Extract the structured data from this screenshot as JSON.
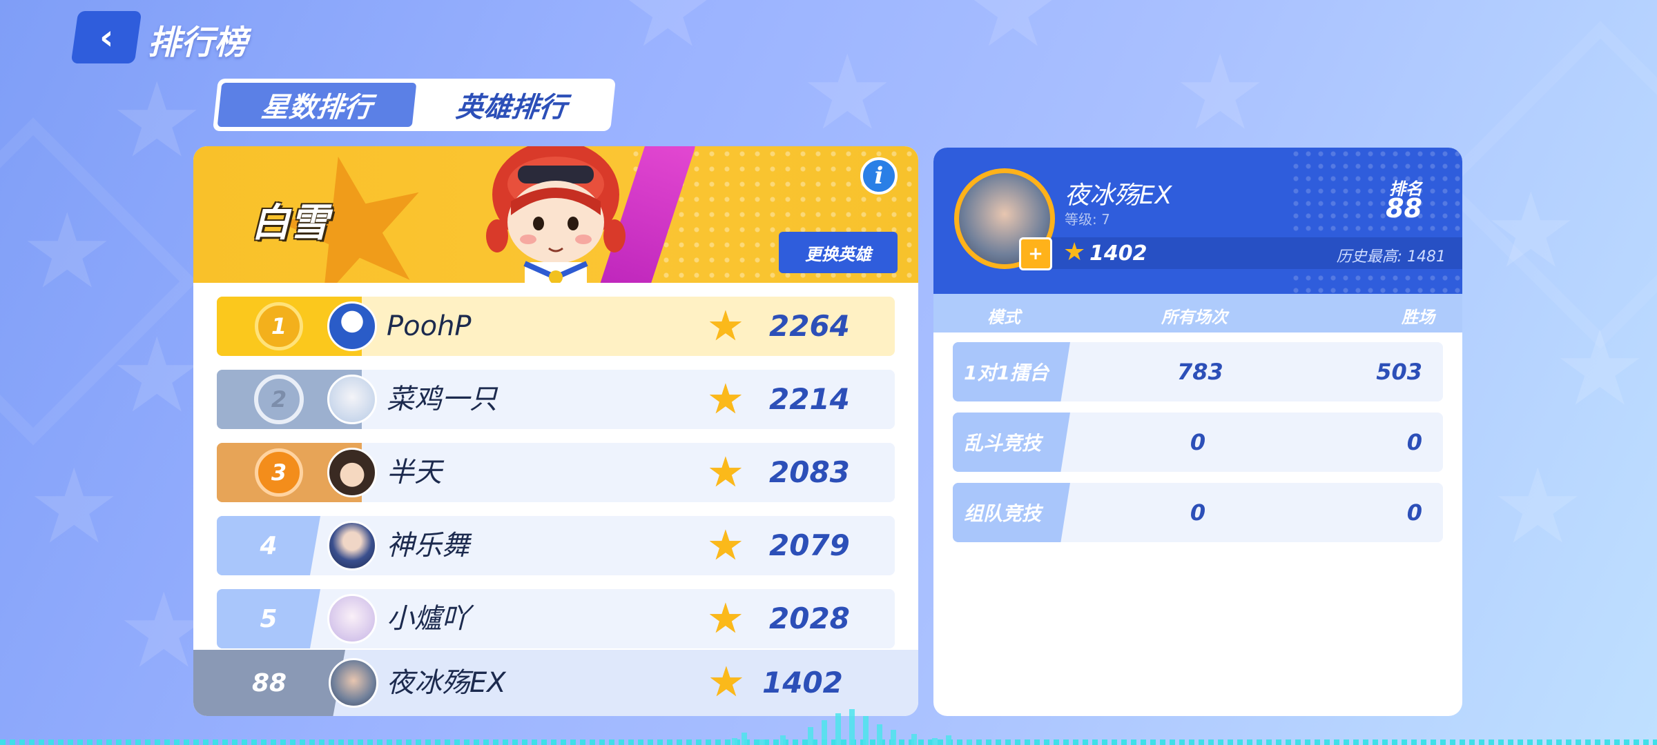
{
  "header": {
    "title": "排行榜"
  },
  "tabs": [
    {
      "label": "星数排行",
      "active": true
    },
    {
      "label": "英雄排行",
      "active": false
    }
  ],
  "hero_banner": {
    "hero_name": "白雪",
    "change_button": "更换英雄"
  },
  "leaderboard": [
    {
      "rank": "1",
      "name": "PoohP",
      "stars": "2264"
    },
    {
      "rank": "2",
      "name": "菜鸡一只",
      "stars": "2214"
    },
    {
      "rank": "3",
      "name": "半天",
      "stars": "2083"
    },
    {
      "rank": "4",
      "name": "神乐舞",
      "stars": "2079"
    },
    {
      "rank": "5",
      "name": "小爐吖",
      "stars": "2028"
    }
  ],
  "self_row": {
    "rank": "88",
    "name": "夜冰殇EX",
    "stars": "1402"
  },
  "profile": {
    "name": "夜冰殇EX",
    "level": "等级: 7",
    "rank_label": "排名",
    "rank_value": "88",
    "stars": "1402",
    "history_best": "历史最高: 1481"
  },
  "stats": {
    "headers": {
      "mode": "模式",
      "all": "所有场次",
      "wins": "胜场"
    },
    "rows": [
      {
        "mode": "1对1擂台",
        "all": "783",
        "wins": "503"
      },
      {
        "mode": "乱斗竞技",
        "all": "0",
        "wins": "0"
      },
      {
        "mode": "组队竞技",
        "all": "0",
        "wins": "0"
      }
    ]
  },
  "colors": {
    "primary": "#2f5ddc",
    "gold": "#fbc81d",
    "silver": "#9cb0cf",
    "bronze": "#e7a457",
    "row_bg": "#eef3fd"
  }
}
